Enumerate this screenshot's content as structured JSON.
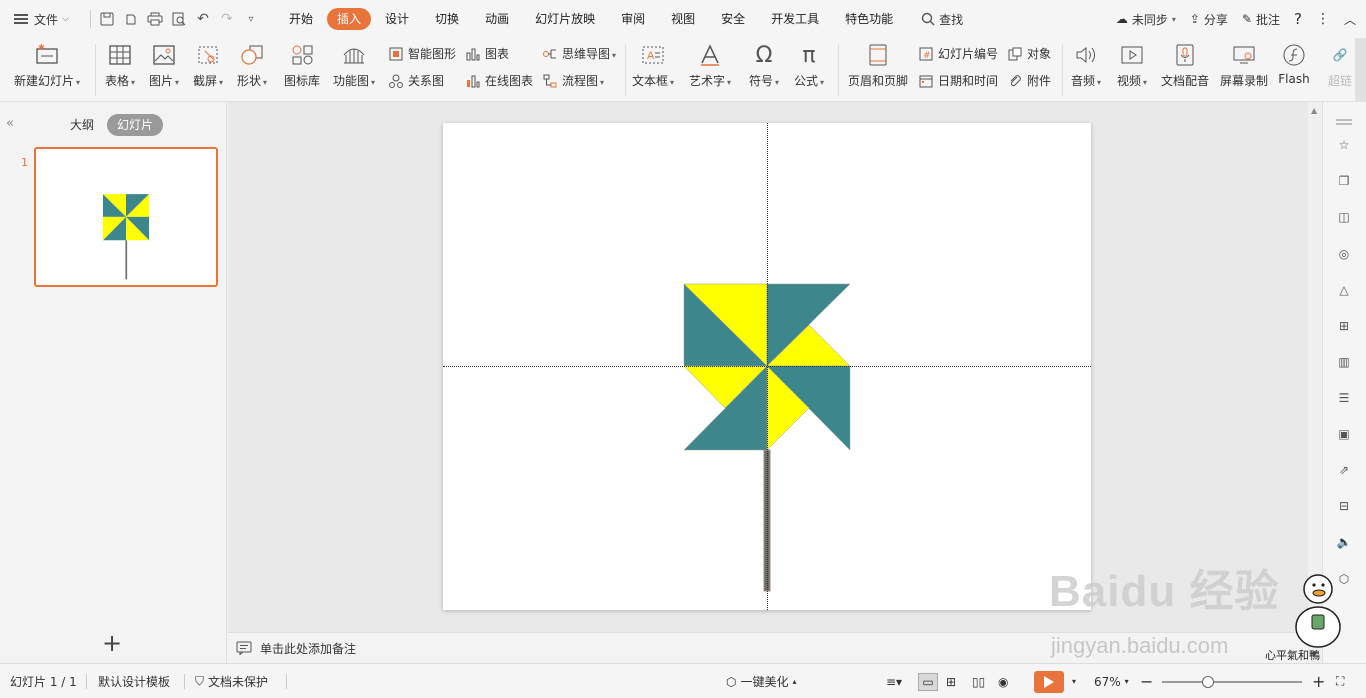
{
  "menu": {
    "file": "文件",
    "tabs": [
      "开始",
      "插入",
      "设计",
      "切换",
      "动画",
      "幻灯片放映",
      "审阅",
      "视图",
      "安全",
      "开发工具",
      "特色功能"
    ],
    "active_tab": "插入",
    "search": "查找",
    "right": {
      "sync": "未同步",
      "share": "分享",
      "comment": "批注",
      "help": "?"
    }
  },
  "ribbon": {
    "new_slide": "新建幻灯片",
    "table": "表格",
    "picture": "图片",
    "screenshot": "截屏",
    "shape": "形状",
    "icon_lib": "图标库",
    "function_chart": "功能图",
    "smart_shape": "智能图形",
    "chart": "图表",
    "relation": "关系图",
    "online_chart": "在线图表",
    "mindmap": "思维导图",
    "flowchart": "流程图",
    "textbox": "文本框",
    "wordart": "艺术字",
    "symbol": "符号",
    "formula": "公式",
    "header_footer": "页眉和页脚",
    "slide_number": "幻灯片编号",
    "object": "对象",
    "datetime": "日期和时间",
    "attachment": "附件",
    "audio": "音频",
    "video": "视频",
    "doc_voice": "文档配音",
    "screen_record": "屏幕录制",
    "flash": "Flash",
    "hyperlink": "超链"
  },
  "left_panel": {
    "outline": "大纲",
    "slides": "幻灯片",
    "slide_number": "1"
  },
  "notes_placeholder": "单击此处添加备注",
  "status": {
    "slide_info": "幻灯片 1 / 1",
    "template": "默认设计模板",
    "protection": "文档未保护",
    "beautify": "一键美化",
    "zoom": "67%"
  },
  "watermark": {
    "brand": "Baidu 经验",
    "url": "jingyan.baidu.com",
    "motto": "心平氣和鴨"
  },
  "colors": {
    "accent": "#e8743c",
    "pinwheel_teal": "#3d878c",
    "pinwheel_yellow": "#ffff00",
    "stick": "#6b6b6b"
  }
}
